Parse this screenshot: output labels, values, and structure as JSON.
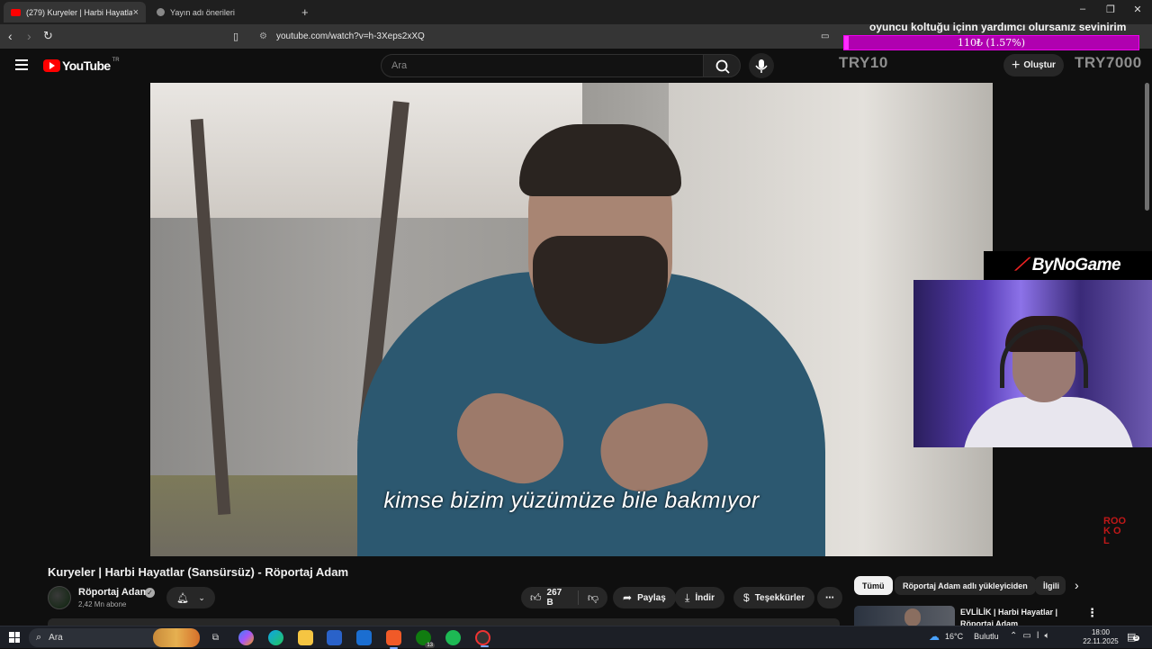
{
  "browser": {
    "tabs": [
      {
        "label": "(279) Kuryeler | Harbi Hayatlar (S...",
        "active": true
      },
      {
        "label": "Yayın adı önerileri",
        "active": false
      }
    ],
    "close_glyph": "×",
    "url": "youtube.com/watch?v=h-3Xeps2xXQ",
    "window_controls": [
      "–",
      "❐",
      "✕"
    ]
  },
  "youtube": {
    "logo_text": "YouTube",
    "country_code": "TR",
    "search_placeholder": "Ara",
    "create_label": "Oluştur",
    "video": {
      "subtitle": "kimse bizim yüzümüze bile bakmıyor",
      "title": "Kuryeler | Harbi Hayatlar (Sansürsüz) - Röportaj Adam"
    },
    "channel": {
      "name": "Röportaj Adam",
      "subscribers": "2,42 Mn abone"
    },
    "actions": {
      "likes": "267 B",
      "share": "Paylaş",
      "download": "İndir",
      "thanks": "Teşekkürler",
      "more": "⋯"
    },
    "chips": [
      "Tümü",
      "Röportaj Adam adlı yükleyiciden",
      "İlgili"
    ],
    "recommendation": {
      "title": "EVLİLİK | Harbi Hayatlar | Röportaj Adam"
    }
  },
  "overlay": {
    "donation_text": "oyuncu koltuğu içinn yardımcı olursanız sevinirim",
    "donation_bar_label": "110₺ (1.57%)",
    "donation_progress_percent": 1.57,
    "try_left": "TRY10",
    "try_right": "TRY7000",
    "sponsor": "ByNoGame",
    "corner_logo": "ROOK OL"
  },
  "taskbar": {
    "search_label": "Ara",
    "weather_temp": "16°C",
    "weather_condition": "Bulutlu",
    "time": "18:00",
    "date": "22.11.2025",
    "notifications": "5",
    "app_badge": "13"
  },
  "colors": {
    "accent_red": "#ff0000",
    "donation_magenta": "#ff2cff",
    "background": "#0f0f0f"
  }
}
